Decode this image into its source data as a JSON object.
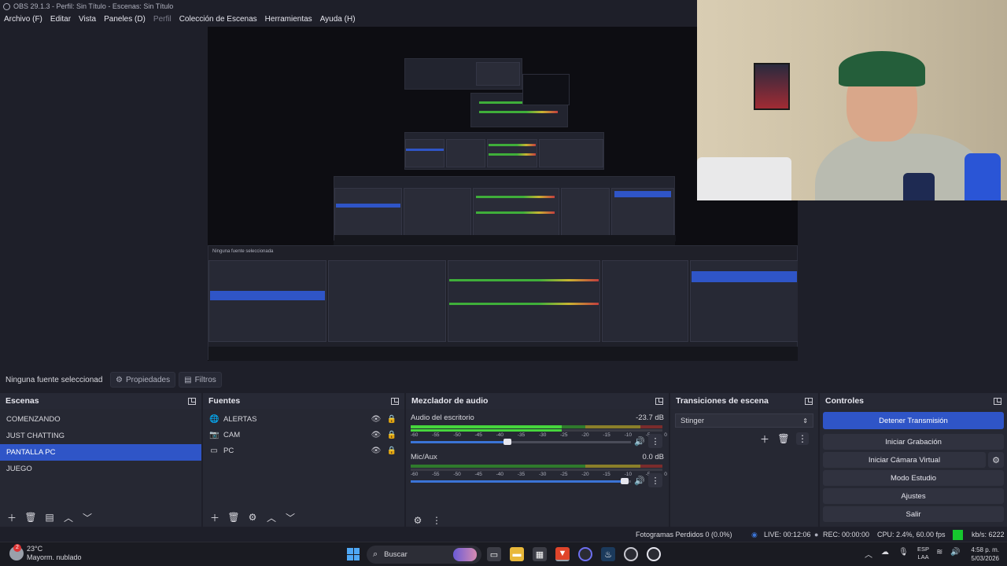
{
  "window": {
    "title": "OBS 29.1.3 - Perfil: Sin Título - Escenas: Sin Título"
  },
  "menu": {
    "items": [
      {
        "label": "Archivo (F)",
        "dim": false
      },
      {
        "label": "Editar",
        "dim": false
      },
      {
        "label": "Vista",
        "dim": false
      },
      {
        "label": "Paneles (D)",
        "dim": false
      },
      {
        "label": "Perfil",
        "dim": true
      },
      {
        "label": "Colección de Escenas",
        "dim": false
      },
      {
        "label": "Herramientas",
        "dim": false
      },
      {
        "label": "Ayuda (H)",
        "dim": false
      }
    ]
  },
  "source_bar": {
    "no_source": "Ninguna fuente seleccionad",
    "properties": "Propiedades",
    "filters": "Filtros"
  },
  "scenes": {
    "title": "Escenas",
    "items": [
      "COMENZANDO",
      "JUST CHATTING",
      "PANTALLA PC",
      "JUEGO"
    ],
    "selected_index": 2
  },
  "sources": {
    "title": "Fuentes",
    "items": [
      {
        "name": "ALERTAS",
        "icon": "globe-icon"
      },
      {
        "name": "CAM",
        "icon": "camera-icon"
      },
      {
        "name": "PC",
        "icon": "monitor-icon"
      }
    ]
  },
  "mixer": {
    "title": "Mezclador de audio",
    "scale": [
      "-60",
      "-55",
      "-50",
      "-45",
      "-40",
      "-35",
      "-30",
      "-25",
      "-20",
      "-15",
      "-10",
      "-5",
      "0"
    ],
    "channels": [
      {
        "name": "Audio del escritorio",
        "db": "-23.7 dB",
        "level": 0.6,
        "fader": 0.44
      },
      {
        "name": "Mic/Aux",
        "db": "0.0 dB",
        "level": 0.0,
        "fader": 0.97
      }
    ]
  },
  "transitions": {
    "title": "Transiciones de escena",
    "selected": "Stinger"
  },
  "controls": {
    "title": "Controles",
    "stop_stream": "Detener Transmisión",
    "start_record": "Iniciar Grabación",
    "virtual_cam": "Iniciar Cámara Virtual",
    "studio_mode": "Modo Estudio",
    "settings": "Ajustes",
    "exit": "Salir"
  },
  "status": {
    "dropped": "Fotogramas Perdidos 0 (0.0%)",
    "live": "LIVE: 00:12:06",
    "rec": "REC: 00:00:00",
    "cpu": "CPU: 2.4%, 60.00 fps",
    "kbs": "kb/s: 6222",
    "indicator_color": "#16c72e"
  },
  "taskbar": {
    "weather_temp": "23°C",
    "weather_desc": "Mayorm. nublado",
    "search": "Buscar",
    "lang1": "ESP",
    "lang2": "LAA",
    "time": "4:58 p. m.",
    "date": "5/03/2026"
  }
}
